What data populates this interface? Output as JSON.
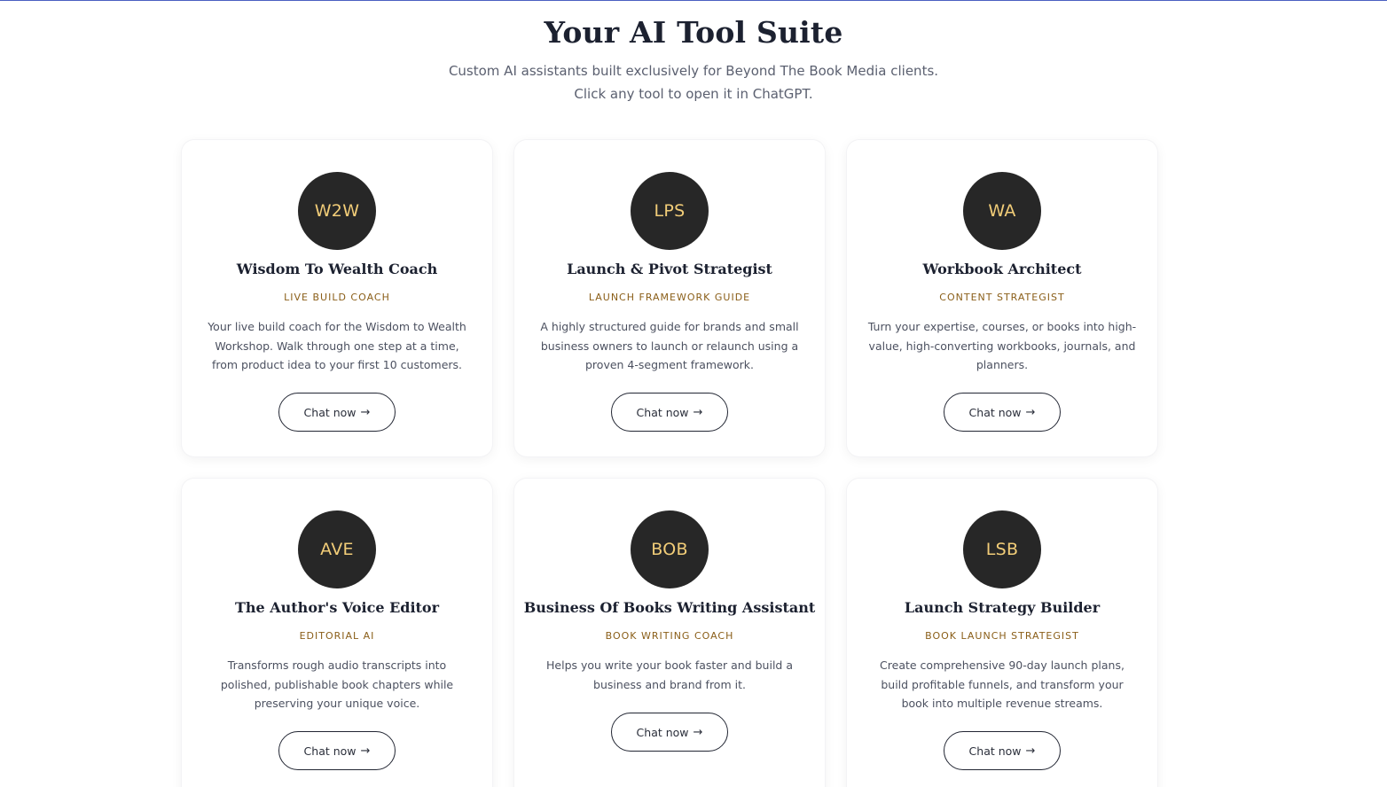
{
  "header": {
    "title": "Your AI Tool Suite",
    "subtitle": "Custom AI assistants built exclusively for Beyond The Book Media clients. Click any tool to open it in ChatGPT."
  },
  "colors": {
    "accent_line": "#4a5fc1",
    "avatar_bg": "#272727",
    "avatar_text": "#f2cd78",
    "role_text": "#8a5e18"
  },
  "tools": [
    {
      "initials": "W2W",
      "name": "Wisdom To Wealth Coach",
      "role": "LIVE BUILD COACH",
      "description": "Your live build coach for the Wisdom to Wealth Workshop. Walk through one step at a time, from product idea to your first 10 customers.",
      "button": "Chat now",
      "button_icon": "arrow-right-icon"
    },
    {
      "initials": "LPS",
      "name": "Launch & Pivot Strategist",
      "role": "LAUNCH FRAMEWORK GUIDE",
      "description": "A highly structured guide for brands and small business owners to launch or relaunch using a proven 4-segment framework.",
      "button": "Chat now",
      "button_icon": "arrow-right-icon"
    },
    {
      "initials": "WA",
      "name": "Workbook Architect",
      "role": "CONTENT STRATEGIST",
      "description": "Turn your expertise, courses, or books into high-value, high-converting workbooks, journals, and planners.",
      "button": "Chat now",
      "button_icon": "arrow-right-icon"
    },
    {
      "initials": "AVE",
      "name": "The Author's Voice Editor",
      "role": "EDITORIAL AI",
      "description": "Transforms rough audio transcripts into polished, publishable book chapters while preserving your unique voice.",
      "button": "Chat now",
      "button_icon": "arrow-right-icon"
    },
    {
      "initials": "BOB",
      "name": "Business Of Books Writing Assistant",
      "role": "BOOK WRITING COACH",
      "description": "Helps you write your book faster and build a business and brand from it.",
      "button": "Chat now",
      "button_icon": "arrow-right-icon"
    },
    {
      "initials": "LSB",
      "name": "Launch Strategy Builder",
      "role": "BOOK LAUNCH STRATEGIST",
      "description": "Create comprehensive 90-day launch plans, build profitable funnels, and transform your book into multiple revenue streams.",
      "button": "Chat now",
      "button_icon": "arrow-right-icon"
    }
  ]
}
